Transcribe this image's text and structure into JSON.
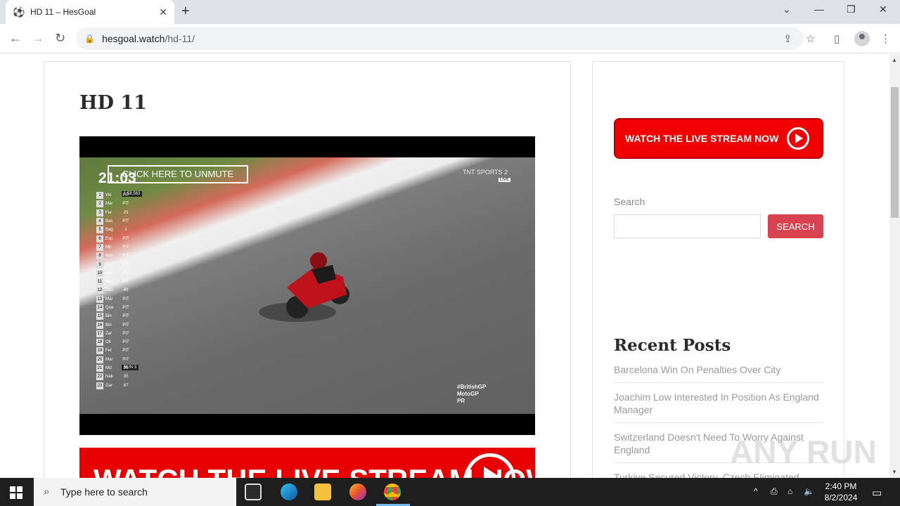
{
  "browser": {
    "tab_title": "HD 11 – HesGoal",
    "new_tab": "+",
    "url_host": "hesgoal.watch",
    "url_path": "/hd-11/"
  },
  "page": {
    "title": "HD 11",
    "video": {
      "unmute_label": "CLICK HERE TO UNMUTE",
      "clock": "21:03",
      "broadcaster": "TNT SPORTS 2",
      "live": "LIVE",
      "lap_time": "1:58.563",
      "run_label": "RUN 3",
      "hashtag": "#BritishGP",
      "series": "MotoGP",
      "tag": "PR",
      "standings": [
        {
          "pos": "1",
          "name": "Vin",
          "tag": "PIT"
        },
        {
          "pos": "2",
          "name": "Mar",
          "tag": "PIT"
        },
        {
          "pos": "3",
          "name": "Fer",
          "tag": "25"
        },
        {
          "pos": "4",
          "name": "Bas",
          "tag": "PIT"
        },
        {
          "pos": "5",
          "name": "Bag",
          "tag": "1"
        },
        {
          "pos": "6",
          "name": "Esp",
          "tag": "PIT"
        },
        {
          "pos": "7",
          "name": "Mil",
          "tag": "PIT"
        },
        {
          "pos": "8",
          "name": "Aco",
          "tag": "PIT"
        },
        {
          "pos": "9",
          "name": "Bez",
          "tag": "PIT"
        },
        {
          "pos": "10",
          "name": "Mar",
          "tag": "PIT"
        },
        {
          "pos": "11",
          "name": "Mar",
          "tag": "PIT"
        },
        {
          "pos": "12",
          "name": "DiG",
          "tag": "49"
        },
        {
          "pos": "13",
          "name": "Mar",
          "tag": "PIT"
        },
        {
          "pos": "14",
          "name": "Qua",
          "tag": "PIT"
        },
        {
          "pos": "15",
          "name": "Bin",
          "tag": "PIT"
        },
        {
          "pos": "16",
          "name": "Bin",
          "tag": "PIT"
        },
        {
          "pos": "17",
          "name": "Zar",
          "tag": "PIT"
        },
        {
          "pos": "18",
          "name": "Olt",
          "tag": "PIT"
        },
        {
          "pos": "19",
          "name": "Fer",
          "tag": "PIT"
        },
        {
          "pos": "20",
          "name": "Mar",
          "tag": "PIT"
        },
        {
          "pos": "21",
          "name": "Miz",
          "tag": "36"
        },
        {
          "pos": "22",
          "name": "Nak",
          "tag": "30"
        },
        {
          "pos": "23",
          "name": "Gar",
          "tag": "87"
        }
      ]
    },
    "banner_text": "WATCH THE LIVE STREAM NOW"
  },
  "sidebar": {
    "cta": "WATCH THE LIVE STREAM NOW",
    "search_label": "Search",
    "search_button": "SEARCH",
    "recent_title": "Recent Posts",
    "posts": [
      "Barcelona Win On Penalties Over City",
      "Joachim Low Interested In Position As England Manager",
      "Switzerland Doesn't Need To Worry Against England",
      "Turkiye Secured Victory, Czech Eliminated"
    ]
  },
  "watermark": "ANY RUN",
  "taskbar": {
    "search_placeholder": "Type here to search",
    "time": "2:40 PM",
    "date": "8/2/2024"
  },
  "colors": {
    "accent_red": "#f00000",
    "search_button": "#d9434f"
  }
}
